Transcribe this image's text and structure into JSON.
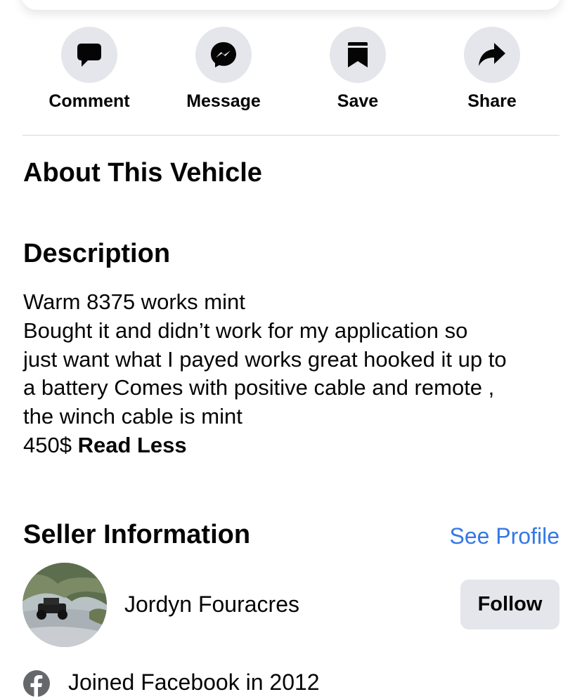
{
  "actions": [
    {
      "label": "Comment",
      "icon": "comment-icon"
    },
    {
      "label": "Message",
      "icon": "messenger-icon"
    },
    {
      "label": "Save",
      "icon": "bookmark-icon"
    },
    {
      "label": "Share",
      "icon": "share-icon"
    }
  ],
  "about": {
    "title": "About This Vehicle"
  },
  "description": {
    "title": "Description",
    "lines": [
      "Warm 8375 works mint",
      "Bought it and didn’t work for my application so",
      "just want what I payed works great hooked it up to",
      "a battery Comes with positive cable and remote ,",
      "the winch cable is mint"
    ],
    "price_text": "450$ ",
    "read_less": "Read Less"
  },
  "seller": {
    "title": "Seller Information",
    "see_profile": "See Profile",
    "name": "Jordyn Fouracres",
    "follow": "Follow",
    "joined": "Joined Facebook in 2012"
  },
  "colors": {
    "link": "#3578e5",
    "button_bg": "#e4e6eb",
    "text": "#050505"
  }
}
